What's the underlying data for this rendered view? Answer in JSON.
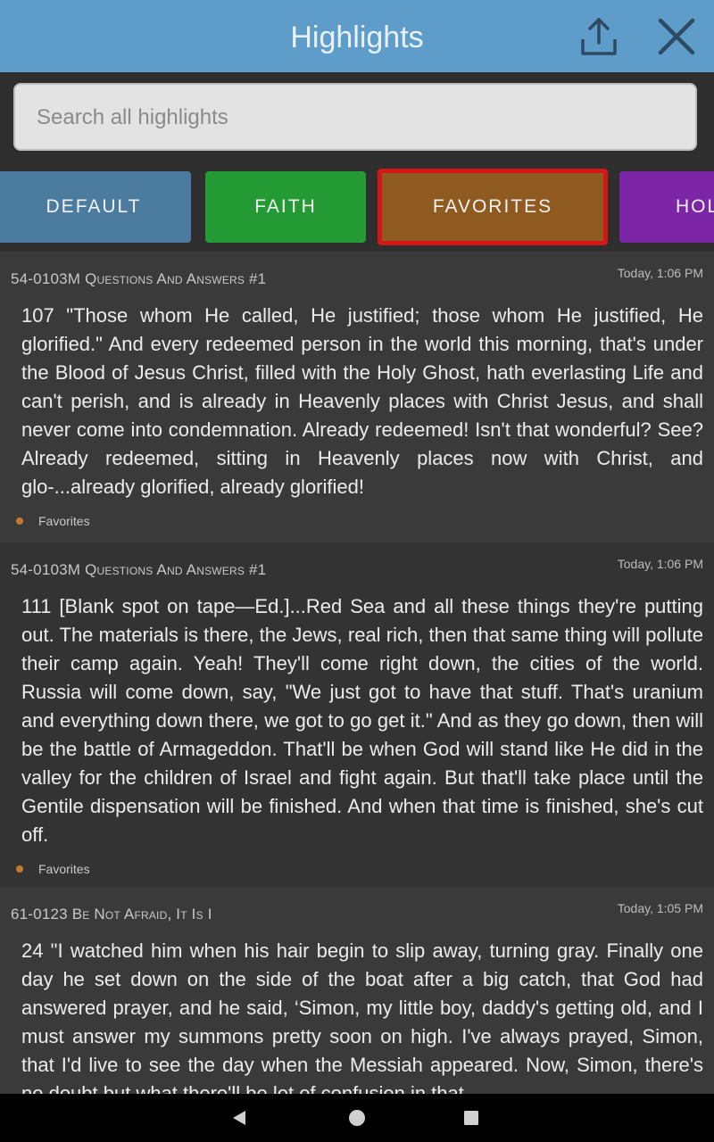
{
  "header": {
    "title": "Highlights",
    "share_icon": "share-upload-icon",
    "close_icon": "close-icon"
  },
  "search": {
    "placeholder": "Search all highlights",
    "value": ""
  },
  "tags": [
    {
      "label": "DEFAULT",
      "color": "#4b7ca0",
      "selected": false
    },
    {
      "label": "FAITH",
      "color": "#249a34",
      "selected": false
    },
    {
      "label": "FAVORITES",
      "color": "#8e5a1f",
      "selected": true,
      "border": "#d41616"
    },
    {
      "label": "HOL",
      "color": "#7c25a6",
      "selected": false
    }
  ],
  "highlights": [
    {
      "title": "54-0103M Questions And Answers #1",
      "time": "Today, 1:06 PM",
      "text": "107 \"Those whom He called, He justified; those whom He justified, He glorified.\" And every redeemed person in the world this morning, that's under the Blood of Jesus Christ, filled with the Holy Ghost, hath everlasting Life and can't perish, and is already in Heavenly places with Christ Jesus, and shall never come into condemnation. Already redeemed! Isn't that wonderful? See? Already redeemed, sitting in Heavenly places now with Christ, and glo-...already glorified, already glorified!",
      "tag": "Favorites",
      "tag_color": "#c47a2a"
    },
    {
      "title": "54-0103M Questions And Answers #1",
      "time": "Today, 1:06 PM",
      "text": "111 [Blank spot on tape—Ed.]...Red Sea and all these things they're putting out. The materials is there, the Jews, real rich, then that same thing will pollute their camp again. Yeah! They'll come right down, the cities of the world. Russia will come down, say, \"We just got to have that stuff. That's uranium and everything down there, we got to go get it.\" And as they go down, then will be the battle of Armageddon. That'll be when God will stand like He did in the valley for the children of Israel and fight again. But that'll take place until the Gentile dispensation will be finished. And when that time is finished, she's cut off.",
      "tag": "Favorites",
      "tag_color": "#c47a2a"
    },
    {
      "title": "61-0123 Be Not Afraid, It Is I",
      "time": "Today, 1:05 PM",
      "text": "24 \"I watched him when his hair begin to slip away, turning gray. Finally one day he set down on the side of the boat after a big catch, that God had answered prayer, and he said, ‘Simon, my little boy, daddy's getting old, and I must answer my summons pretty soon on high. I've always prayed, Simon, that I'd live to see the day when the Messiah appeared. Now, Simon, there's no doubt but what there'll be lot of confusion in that",
      "tag": "",
      "tag_color": "#c47a2a"
    }
  ],
  "navbar": {
    "back_icon": "back-triangle-icon",
    "home_icon": "home-circle-icon",
    "recents_icon": "recents-square-icon"
  }
}
